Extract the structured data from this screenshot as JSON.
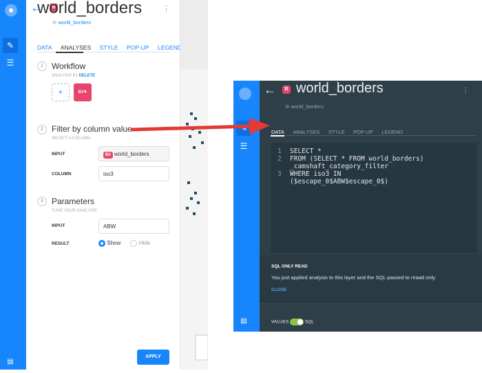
{
  "left_panel": {
    "title": "world_borders",
    "source": "world_borders",
    "badge": "B",
    "tabs": [
      "DATA",
      "ANALYSES",
      "STYLE",
      "POP-UP",
      "LEGEND"
    ],
    "workflow": {
      "step": "1",
      "title": "Workflow",
      "subtitle": "ANALYSIS B1",
      "delete": "DELETE",
      "add": "+",
      "node": "B1"
    },
    "filter": {
      "step": "2",
      "title": "Filter by column value",
      "subtitle": "SELECT A COLUMN",
      "input_label": "INPUT",
      "input_badge": "B0",
      "input_value": "world_borders",
      "column_label": "COLUMN",
      "column_value": "iso3"
    },
    "params": {
      "step": "3",
      "title": "Parameters",
      "subtitle": "TUNE YOUR ANALYSIS",
      "input_label": "INPUT",
      "input_value": "ABW",
      "result_label": "RESULT",
      "show": "Show",
      "hide": "Hide"
    },
    "apply": "APPLY"
  },
  "right_panel": {
    "title": "world_borders",
    "source": "world_borders",
    "badge": "B",
    "tabs": [
      "DATA",
      "ANALYSES",
      "STYLE",
      "POP-UP",
      "LEGEND"
    ],
    "code": [
      {
        "n": "1",
        "text": "SELECT *"
      },
      {
        "n": "2",
        "text": "FROM (SELECT * FROM world_borders)\n_camshaft_category_filter"
      },
      {
        "n": "3",
        "text": "WHERE iso3 IN\n($escape_0$ABW$escape_0$)"
      }
    ],
    "notice_title": "SQL ONLY READ",
    "notice_text": "You just applied analysis to this layer and the SQL passed to reaad only.",
    "close": "CLOSE",
    "toggle_values": "VALUES",
    "toggle_sql": "SQL"
  },
  "colors": {
    "accent": "#1785fb",
    "badge": "#e6456c",
    "arrow": "#e53935"
  }
}
